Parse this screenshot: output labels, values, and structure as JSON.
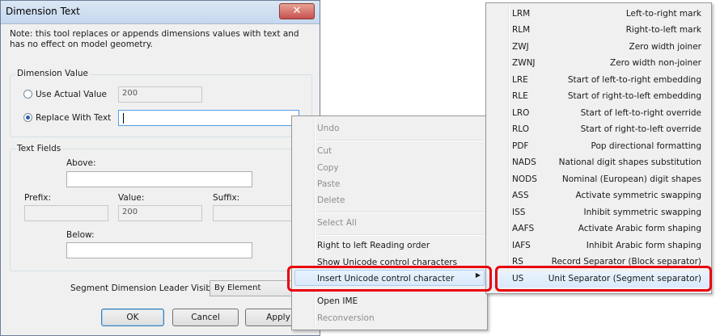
{
  "dialog": {
    "title": "Dimension Text",
    "close_symbol": "✕",
    "note": "Note: this tool replaces or appends dimensions values with text and has no effect on model geometry.",
    "dimension_value": {
      "label": "Dimension Value",
      "use_actual": {
        "label": "Use Actual Value",
        "value": "200",
        "checked": false
      },
      "replace_with_text": {
        "label": "Replace With Text",
        "value": "",
        "checked": true
      }
    },
    "text_fields": {
      "label": "Text Fields",
      "above_label": "Above:",
      "above_value": "",
      "prefix_label": "Prefix:",
      "prefix_value": "",
      "value_label": "Value:",
      "value_value": "200",
      "suffix_label": "Suffix:",
      "suffix_value": "",
      "below_label": "Below:",
      "below_value": ""
    },
    "leader_visibility": {
      "label": "Segment Dimension Leader Visibility:",
      "selected": "By Element"
    },
    "buttons": {
      "ok": "OK",
      "cancel": "Cancel",
      "apply": "Apply"
    }
  },
  "context_menu": {
    "items": [
      {
        "label": "Undo",
        "enabled": false
      },
      {
        "label": "Cut",
        "enabled": false
      },
      {
        "label": "Copy",
        "enabled": false
      },
      {
        "label": "Paste",
        "enabled": false
      },
      {
        "label": "Delete",
        "enabled": false
      },
      {
        "label": "Select All",
        "enabled": false
      },
      {
        "label": "Right to left Reading order",
        "enabled": true
      },
      {
        "label": "Show Unicode control characters",
        "enabled": true
      },
      {
        "label": "Insert Unicode control character",
        "enabled": true,
        "highlighted": true,
        "has_submenu": true
      },
      {
        "label": "Open IME",
        "enabled": true
      },
      {
        "label": "Reconversion",
        "enabled": false
      }
    ],
    "submenu_arrow": "▶"
  },
  "submenu": {
    "items": [
      {
        "code": "LRM",
        "desc": "Left-to-right mark"
      },
      {
        "code": "RLM",
        "desc": "Right-to-left mark"
      },
      {
        "code": "ZWJ",
        "desc": "Zero width joiner"
      },
      {
        "code": "ZWNJ",
        "desc": "Zero width non-joiner"
      },
      {
        "code": "LRE",
        "desc": "Start of left-to-right embedding"
      },
      {
        "code": "RLE",
        "desc": "Start of right-to-left embedding"
      },
      {
        "code": "LRO",
        "desc": "Start of left-to-right override"
      },
      {
        "code": "RLO",
        "desc": "Start of right-to-left override"
      },
      {
        "code": "PDF",
        "desc": "Pop directional formatting"
      },
      {
        "code": "NADS",
        "desc": "National digit shapes substitution"
      },
      {
        "code": "NODS",
        "desc": "Nominal (European) digit shapes"
      },
      {
        "code": "ASS",
        "desc": "Activate symmetric swapping"
      },
      {
        "code": "ISS",
        "desc": "Inhibit symmetric swapping"
      },
      {
        "code": "AAFS",
        "desc": "Activate Arabic form shaping"
      },
      {
        "code": "IAFS",
        "desc": "Inhibit Arabic form shaping"
      },
      {
        "code": "RS",
        "desc": "Record Separator (Block separator)"
      },
      {
        "code": "US",
        "desc": "Unit Separator (Segment separator)",
        "highlighted": true
      }
    ]
  },
  "colors": {
    "highlight_box": "#e8000c",
    "dialog_bg": "#f0f0f0",
    "menu_hover": "#d9e9fc"
  }
}
